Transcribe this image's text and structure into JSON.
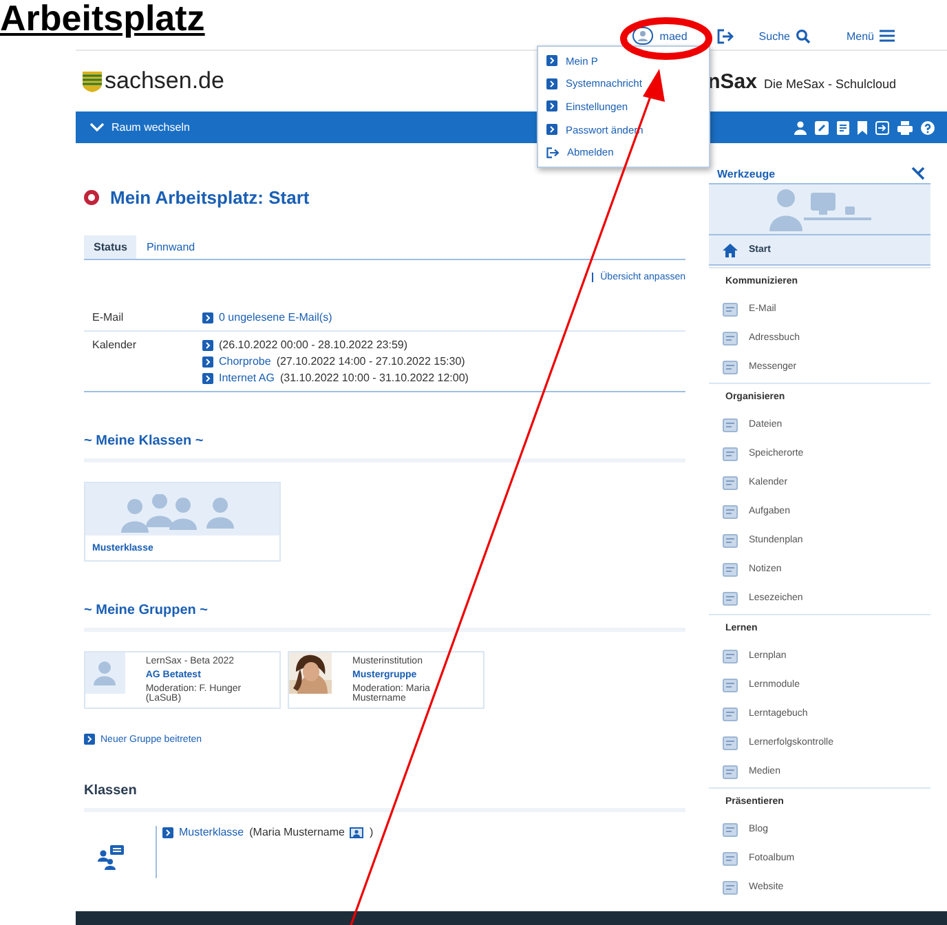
{
  "doc_heading": "Arbeitsplatz",
  "topbar": {
    "user": "maed",
    "search": "Suche",
    "menu": "Menü"
  },
  "user_menu": [
    {
      "label": "Mein P",
      "kind": "link"
    },
    {
      "label": "Systemnachricht",
      "kind": "link"
    },
    {
      "label": "Einstellungen",
      "kind": "link"
    },
    {
      "label": "Passwort ändern",
      "kind": "link"
    },
    {
      "label": "Abmelden",
      "kind": "logout"
    }
  ],
  "brand": {
    "site": "sachsen.de",
    "product": "nSax",
    "tagline": "Die MeSax - Schulcloud"
  },
  "nav_bar": {
    "room_switch": "Raum wechseln"
  },
  "page_title": "Mein Arbeitsplatz: Start",
  "tabs": [
    {
      "label": "Status",
      "selected": true
    },
    {
      "label": "Pinnwand",
      "selected": false
    }
  ],
  "customize_link": "Übersicht anpassen",
  "status_rows": [
    {
      "label": "E-Mail",
      "entries": [
        {
          "link": "0 ungelesene E-Mail(s)"
        }
      ]
    },
    {
      "label": "Kalender",
      "entries": [
        {
          "detail": "(26.10.2022 00:00 - 28.10.2022 23:59)"
        },
        {
          "link": "Chorprobe",
          "detail": "(27.10.2022 14:00 - 27.10.2022 15:30)"
        },
        {
          "link": "Internet AG",
          "detail": "(31.10.2022 10:00 - 31.10.2022 12:00)"
        }
      ]
    }
  ],
  "classes_heading": "~ Meine Klassen ~",
  "class_cards": [
    {
      "name": "Musterklasse"
    }
  ],
  "groups_heading": "~ Meine Gruppen ~",
  "group_cards": [
    {
      "institution": "LernSax - Beta 2022",
      "name": "AG Betatest",
      "moderation": "Moderation: F. Hunger (LaSuB)",
      "kind": "avatar"
    },
    {
      "institution": "Musterinstitution",
      "name": "Mustergruppe",
      "moderation": "Moderation: Maria Mustername",
      "kind": "picture"
    }
  ],
  "join_group": "Neuer Gruppe beitreten",
  "klassen_heading": "Klassen",
  "klassen_list": [
    {
      "link": "Musterklasse",
      "detail": "(Maria Mustername",
      "suffix": ")"
    }
  ],
  "sidebar": {
    "title": "Werkzeuge",
    "sections": [
      {
        "items": [
          {
            "label": "Start",
            "selected": true
          }
        ]
      },
      {
        "heading": "Kommunizieren",
        "items": [
          {
            "label": "E-Mail",
            "selected": false
          },
          {
            "label": "Adressbuch",
            "selected": false
          },
          {
            "label": "Messenger",
            "selected": false
          }
        ]
      },
      {
        "heading": "Organisieren",
        "items": [
          {
            "label": "Dateien",
            "selected": false
          },
          {
            "label": "Speicherorte",
            "selected": false
          },
          {
            "label": "Kalender",
            "selected": false
          },
          {
            "label": "Aufgaben",
            "selected": false
          },
          {
            "label": "Stundenplan",
            "selected": false
          },
          {
            "label": "Notizen",
            "selected": false
          },
          {
            "label": "Lesezeichen",
            "selected": false
          }
        ]
      },
      {
        "heading": "Lernen",
        "items": [
          {
            "label": "Lernplan",
            "selected": false
          },
          {
            "label": "Lernmodule",
            "selected": false
          },
          {
            "label": "Lerntagebuch",
            "selected": false
          },
          {
            "label": "Lernerfolgskontrolle",
            "selected": false
          },
          {
            "label": "Medien",
            "selected": false
          }
        ]
      },
      {
        "heading": "Präsentieren",
        "items": [
          {
            "label": "Blog",
            "selected": false
          },
          {
            "label": "Fotoalbum",
            "selected": false
          },
          {
            "label": "Website",
            "selected": false
          }
        ]
      }
    ]
  }
}
